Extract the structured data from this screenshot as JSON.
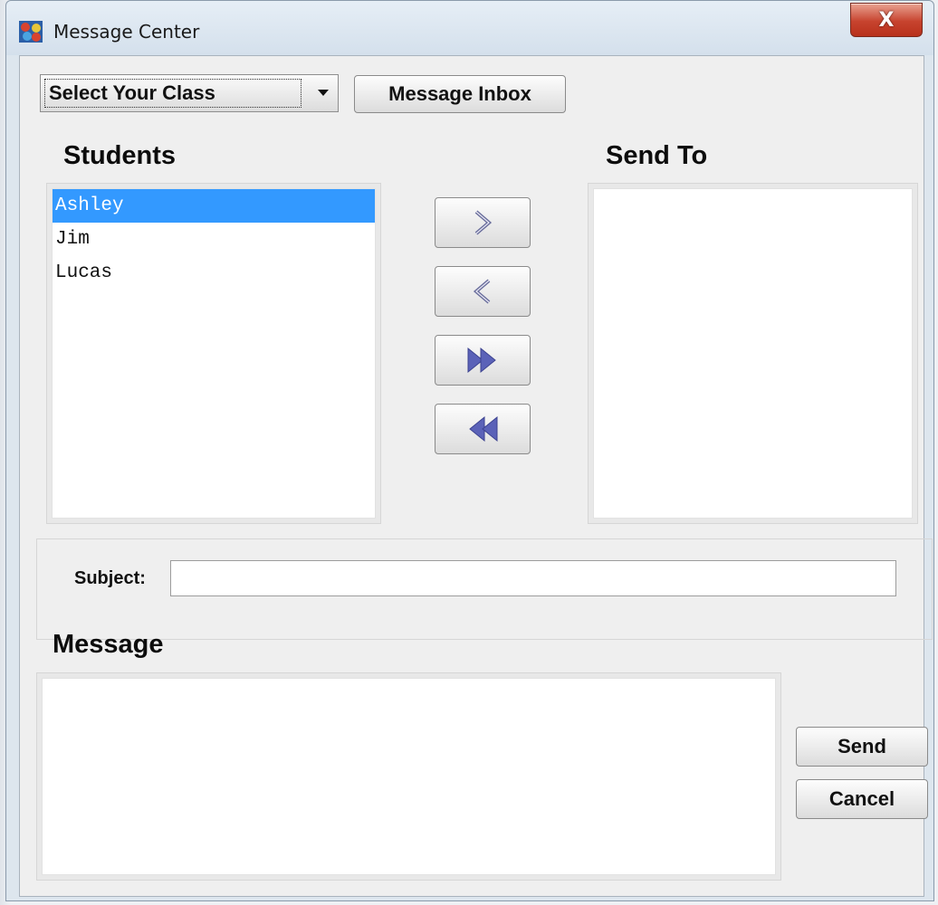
{
  "window": {
    "title": "Message Center",
    "close_label": "X"
  },
  "class_select": {
    "selected": "Select Your Class",
    "icon": "chevron-down-icon"
  },
  "toolbar": {
    "inbox_label": "Message Inbox"
  },
  "students": {
    "heading": "Students",
    "items": [
      "Ashley",
      "Jim",
      "Lucas"
    ],
    "selected": "Ashley"
  },
  "send_to": {
    "heading": "Send To",
    "items": []
  },
  "transfer": {
    "add_one_icon": "chevron-right-icon",
    "remove_one_icon": "chevron-left-icon",
    "add_all_icon": "double-chevron-right-icon",
    "remove_all_icon": "double-chevron-left-icon"
  },
  "subject": {
    "label": "Subject:",
    "value": ""
  },
  "message": {
    "heading": "Message",
    "value": ""
  },
  "actions": {
    "send_label": "Send",
    "cancel_label": "Cancel"
  },
  "colors": {
    "selection": "#3399ff",
    "close_button": "#c7432e",
    "arrow_fill": "#5b62b8"
  }
}
